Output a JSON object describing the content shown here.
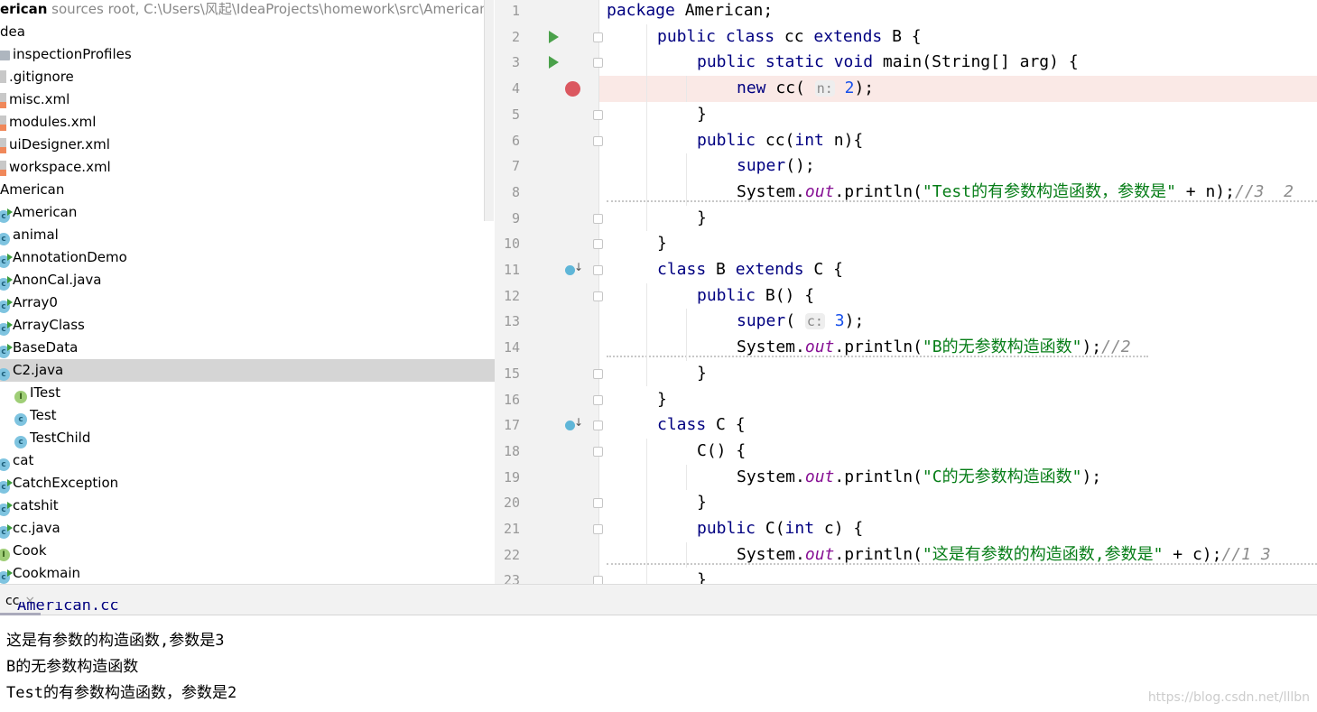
{
  "project_tree": {
    "header": {
      "name": "erican",
      "detail": " sources root,  C:\\Users\\风起\\IdeaProjects\\homework\\src\\American"
    },
    "items": [
      {
        "label": "dea",
        "icon": "none",
        "indent": 0
      },
      {
        "label": "inspectionProfiles",
        "icon": "folder",
        "indent": 1
      },
      {
        "label": ".gitignore",
        "icon": "file",
        "indent": 1
      },
      {
        "label": "misc.xml",
        "icon": "xml",
        "indent": 1
      },
      {
        "label": "modules.xml",
        "icon": "xml",
        "indent": 1
      },
      {
        "label": "uiDesigner.xml",
        "icon": "xml",
        "indent": 1
      },
      {
        "label": "workspace.xml",
        "icon": "xml",
        "indent": 1
      },
      {
        "label": "American",
        "icon": "none",
        "indent": 0
      },
      {
        "label": "American",
        "icon": "class-run",
        "indent": 1
      },
      {
        "label": "animal",
        "icon": "class",
        "indent": 1
      },
      {
        "label": "AnnotationDemo",
        "icon": "class-run",
        "indent": 1
      },
      {
        "label": "AnonCal.java",
        "icon": "class-run",
        "indent": 1
      },
      {
        "label": "Array0",
        "icon": "class-run",
        "indent": 1
      },
      {
        "label": "ArrayClass",
        "icon": "class-run",
        "indent": 1
      },
      {
        "label": "BaseData",
        "icon": "class-run",
        "indent": 1
      },
      {
        "label": "C2.java",
        "icon": "class",
        "indent": 1,
        "selected": true
      },
      {
        "label": "ITest",
        "icon": "interface",
        "indent": 2
      },
      {
        "label": "Test",
        "icon": "class",
        "indent": 2
      },
      {
        "label": "TestChild",
        "icon": "class",
        "indent": 2
      },
      {
        "label": "cat",
        "icon": "class",
        "indent": 1
      },
      {
        "label": "CatchException",
        "icon": "class-run",
        "indent": 1
      },
      {
        "label": "catshit",
        "icon": "class-run",
        "indent": 1
      },
      {
        "label": "cc.java",
        "icon": "class-run",
        "indent": 1
      },
      {
        "label": "Cook",
        "icon": "interface",
        "indent": 1
      },
      {
        "label": "Cookmain",
        "icon": "class-run",
        "indent": 1
      }
    ]
  },
  "editor": {
    "highlight_line": 4,
    "breakpoint_line": 4,
    "run_lines": [
      2,
      3
    ],
    "override_lines": [
      11,
      17
    ],
    "lines": [
      {
        "n": "1",
        "indent": 0,
        "seg": [
          [
            "package",
            "kw"
          ],
          [
            " American;",
            ""
          ]
        ]
      },
      {
        "n": "2",
        "indent": 1,
        "seg": [
          [
            "public class ",
            "kw"
          ],
          [
            "cc ",
            ""
          ],
          [
            "extends ",
            "kw"
          ],
          [
            "B {",
            ""
          ]
        ]
      },
      {
        "n": "3",
        "indent": 2,
        "seg": [
          [
            "public static void ",
            "kw"
          ],
          [
            "main",
            ""
          ],
          [
            "(String[] arg) {",
            ""
          ]
        ]
      },
      {
        "n": "4",
        "indent": 3,
        "seg": [
          [
            "new ",
            "kw"
          ],
          [
            "cc( ",
            ""
          ],
          [
            "n:",
            "hint"
          ],
          [
            " ",
            ""
          ],
          [
            "2",
            "num"
          ],
          [
            ");",
            ""
          ]
        ]
      },
      {
        "n": "5",
        "indent": 2,
        "seg": [
          [
            "}",
            ""
          ]
        ]
      },
      {
        "n": "6",
        "indent": 2,
        "seg": [
          [
            "public ",
            "kw"
          ],
          [
            "cc(",
            ""
          ],
          [
            "int ",
            "kw"
          ],
          [
            "n){",
            ""
          ]
        ]
      },
      {
        "n": "7",
        "indent": 3,
        "seg": [
          [
            "super",
            "kw"
          ],
          [
            "();",
            ""
          ]
        ]
      },
      {
        "n": "8",
        "indent": 3,
        "seg": [
          [
            "System.",
            ""
          ],
          [
            "out",
            "fld"
          ],
          [
            ".println(",
            ""
          ],
          [
            "\"Test的有参数构造函数，参数是\"",
            "str"
          ],
          [
            " + n);",
            ""
          ],
          [
            "//3  2",
            "cm"
          ]
        ]
      },
      {
        "n": "9",
        "indent": 2,
        "seg": [
          [
            "}",
            ""
          ]
        ]
      },
      {
        "n": "10",
        "indent": 1,
        "seg": [
          [
            "}",
            ""
          ]
        ]
      },
      {
        "n": "11",
        "indent": 1,
        "seg": [
          [
            "class ",
            "kw"
          ],
          [
            "B ",
            ""
          ],
          [
            "extends ",
            "kw"
          ],
          [
            "C {",
            ""
          ]
        ]
      },
      {
        "n": "12",
        "indent": 2,
        "seg": [
          [
            "public ",
            "kw"
          ],
          [
            "B() {",
            ""
          ]
        ]
      },
      {
        "n": "13",
        "indent": 3,
        "seg": [
          [
            "super",
            "kw"
          ],
          [
            "( ",
            ""
          ],
          [
            "c:",
            "hint"
          ],
          [
            " ",
            ""
          ],
          [
            "3",
            "num"
          ],
          [
            ");",
            ""
          ]
        ]
      },
      {
        "n": "14",
        "indent": 3,
        "seg": [
          [
            "System.",
            ""
          ],
          [
            "out",
            "fld"
          ],
          [
            ".println(",
            ""
          ],
          [
            "\"B的无参数构造函数\"",
            "str"
          ],
          [
            ");",
            ""
          ],
          [
            "//2",
            "cm"
          ]
        ]
      },
      {
        "n": "15",
        "indent": 2,
        "seg": [
          [
            "}",
            ""
          ]
        ]
      },
      {
        "n": "16",
        "indent": 1,
        "seg": [
          [
            "}",
            ""
          ]
        ]
      },
      {
        "n": "17",
        "indent": 1,
        "seg": [
          [
            "class ",
            "kw"
          ],
          [
            "C {",
            ""
          ]
        ]
      },
      {
        "n": "18",
        "indent": 2,
        "seg": [
          [
            "C() {",
            ""
          ]
        ]
      },
      {
        "n": "19",
        "indent": 3,
        "seg": [
          [
            "System.",
            ""
          ],
          [
            "out",
            "fld"
          ],
          [
            ".println(",
            ""
          ],
          [
            "\"C的无参数构造函数\"",
            "str"
          ],
          [
            ");",
            ""
          ]
        ]
      },
      {
        "n": "20",
        "indent": 2,
        "seg": [
          [
            "}",
            ""
          ]
        ]
      },
      {
        "n": "21",
        "indent": 2,
        "seg": [
          [
            "public ",
            "kw"
          ],
          [
            "C(",
            ""
          ],
          [
            "int ",
            "kw"
          ],
          [
            "c) {",
            ""
          ]
        ]
      },
      {
        "n": "22",
        "indent": 3,
        "seg": [
          [
            "System.",
            ""
          ],
          [
            "out",
            "fld"
          ],
          [
            ".println(",
            ""
          ],
          [
            "\"这是有参数的构造函数,参数是\"",
            "str"
          ],
          [
            " + c);",
            ""
          ],
          [
            "//1 3",
            "cm"
          ]
        ]
      },
      {
        "n": "23",
        "indent": 2,
        "seg": [
          [
            "}",
            ""
          ]
        ]
      }
    ]
  },
  "run_panel": {
    "tab_label": "cc",
    "close": "×",
    "clipped_line": "American.cc",
    "output": [
      "这是有参数的构造函数,参数是3",
      "B的无参数构造函数",
      "Test的有参数构造函数，参数是2"
    ]
  },
  "watermark": "https://blog.csdn.net/lllbn"
}
